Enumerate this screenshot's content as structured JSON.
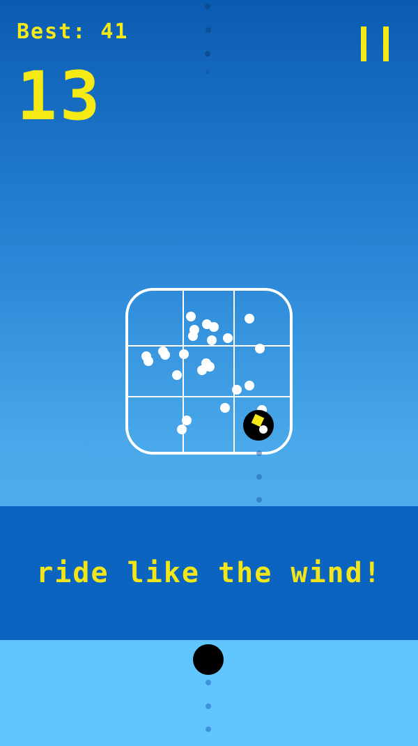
{
  "hud": {
    "best_label": "Best: 41",
    "score": "13"
  },
  "pause": {
    "icon": "pause-icon"
  },
  "banner": {
    "text": "ride like the wind!"
  },
  "colors": {
    "accent_yellow": "#f6ea16",
    "sky_top": "#0a5bb2",
    "sky_bottom": "#5ab8f2",
    "banner_bg": "#0b64bf",
    "ground_bg": "#61c6fd",
    "ball": "#000000",
    "puzzle_white": "#ffffff"
  },
  "icons": {
    "puzzle_grid": "grid-puzzle-icon",
    "player_ball": "player-ball-icon",
    "trail": "trail-dots"
  }
}
